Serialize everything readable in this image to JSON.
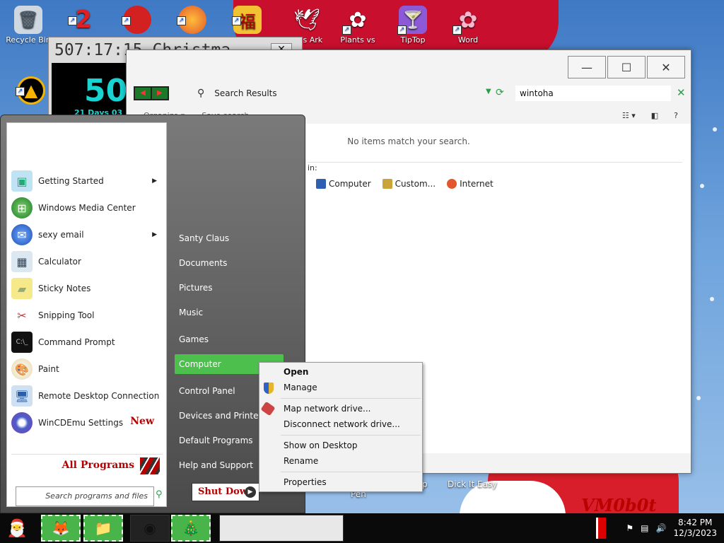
{
  "desktop": {
    "icons": [
      {
        "label": "Recycle Bin",
        "icon": "recycle-bin-icon"
      },
      {
        "label": "",
        "icon": "two-icon"
      },
      {
        "label": "",
        "icon": "creature-icon"
      },
      {
        "label": "",
        "icon": "firefox-icon"
      },
      {
        "label": "",
        "icon": "mahjong-icon"
      },
      {
        "label": "ah's Ark",
        "icon": "dove-icon"
      },
      {
        "label": "Plants vs",
        "icon": "plants-icon"
      },
      {
        "label": "TipTop",
        "icon": "cocktail-icon"
      },
      {
        "label": "Word",
        "icon": "word-icon"
      }
    ],
    "bottom_icons": [
      {
        "label": "Pen"
      },
      {
        "label": "Dick It Easy"
      },
      {
        "label": "p"
      }
    ],
    "watermark": "VM0b0t"
  },
  "clock_gadget": {
    "title": "507:17:15    Christma",
    "big_number": "50",
    "days_text": "21 Days 03"
  },
  "explorer": {
    "address_crumb": "Search Results",
    "search_value": "wintoha",
    "toolbar": {
      "organize": "Organize ▾",
      "save_search": "Save search"
    },
    "no_items": "No items match your search.",
    "search_again_label": "in:",
    "places": [
      {
        "label": "Computer",
        "color": "#2f5fb0"
      },
      {
        "label": "Custom...",
        "color": "#c9a43a"
      },
      {
        "label": "Internet",
        "color": "#e2572c"
      }
    ]
  },
  "start_menu": {
    "programs": [
      {
        "label": "Getting Started",
        "icon": "getting-started-icon",
        "submenu": true
      },
      {
        "label": "Windows Media Center",
        "icon": "media-center-icon",
        "submenu": false
      },
      {
        "label": "sexy email",
        "icon": "thunderbird-icon",
        "submenu": true
      },
      {
        "label": "Calculator",
        "icon": "calculator-icon",
        "submenu": false
      },
      {
        "label": "Sticky Notes",
        "icon": "sticky-notes-icon",
        "submenu": false
      },
      {
        "label": "Snipping Tool",
        "icon": "snipping-tool-icon",
        "submenu": false
      },
      {
        "label": "Command Prompt",
        "icon": "command-prompt-icon",
        "submenu": false
      },
      {
        "label": "Paint",
        "icon": "paint-icon",
        "submenu": false
      },
      {
        "label": "Remote Desktop Connection",
        "icon": "remote-desktop-icon",
        "submenu": false
      },
      {
        "label": "WinCDEmu Settings",
        "icon": "wincdemu-icon",
        "submenu": false
      }
    ],
    "new_badge": "New",
    "all_programs": "All Programs",
    "search_placeholder": "Search programs and files",
    "right_items": [
      "Santy Claus",
      "Documents",
      "Pictures",
      "Music",
      "Games",
      "Computer",
      "Control Panel",
      "Devices and Printers",
      "Default Programs",
      "Help and Support"
    ],
    "selected_right_item": "Computer",
    "shutdown_label": "Shut Down"
  },
  "context_menu": {
    "items": [
      "Open",
      "Manage",
      "Map network drive...",
      "Disconnect network drive...",
      "Show on Desktop",
      "Rename",
      "Properties"
    ]
  },
  "taskbar": {
    "time": "8:42 PM",
    "date": "12/3/2023"
  }
}
